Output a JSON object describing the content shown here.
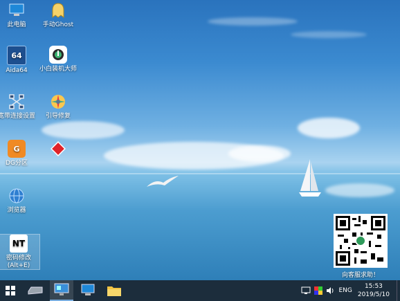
{
  "desktop": {
    "icons": [
      {
        "label": "此电脑",
        "icon": "computer-icon"
      },
      {
        "label": "手动Ghost",
        "icon": "ghost-icon"
      },
      {
        "label": "Aida64",
        "icon": "aida64-icon",
        "glyph": "64"
      },
      {
        "label": "小白装机大师",
        "icon": "installer-icon"
      },
      {
        "label": "宽带连接设置",
        "icon": "network-icon"
      },
      {
        "label": "引导修复",
        "icon": "boot-repair-icon"
      },
      {
        "label": "DG分区",
        "icon": "diskgenius-icon",
        "glyph": "G"
      },
      {
        "label": "",
        "icon": "red-diamond-icon"
      },
      {
        "label": "浏览器",
        "icon": "browser-icon"
      },
      {
        "label": "密码修改\n(Alt+E)",
        "icon": "password-tool-icon",
        "glyph": "NT"
      }
    ],
    "qr_caption": "向客服求助！"
  },
  "taskbar": {
    "buttons": [
      "start-icon",
      "drive-icon",
      "monitor-icon",
      "computer-icon",
      "folder-icon"
    ],
    "language": "ENG",
    "time": "15:53",
    "date": "2019/5/10"
  },
  "colors": {
    "taskbar": "#1c2d3c",
    "sky": "#3b8ad0"
  }
}
